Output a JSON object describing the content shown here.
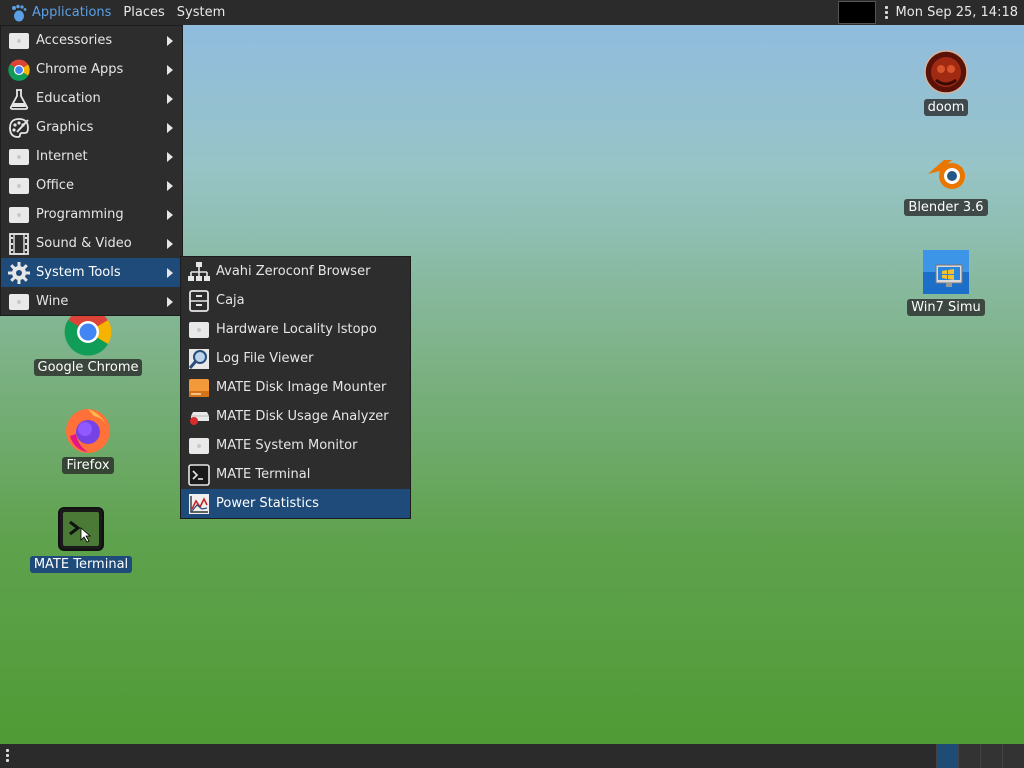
{
  "top_panel": {
    "menus": [
      "Applications",
      "Places",
      "System"
    ],
    "clock": "Mon Sep 25, 14:18"
  },
  "app_menu": {
    "items": [
      {
        "label": "Accessories",
        "icon": "generic-app-icon"
      },
      {
        "label": "Chrome Apps",
        "icon": "chrome-icon"
      },
      {
        "label": "Education",
        "icon": "flask-icon"
      },
      {
        "label": "Graphics",
        "icon": "palette-icon"
      },
      {
        "label": "Internet",
        "icon": "generic-app-icon"
      },
      {
        "label": "Office",
        "icon": "generic-app-icon"
      },
      {
        "label": "Programming",
        "icon": "generic-app-icon"
      },
      {
        "label": "Sound & Video",
        "icon": "film-icon"
      },
      {
        "label": "System Tools",
        "icon": "gear-icon"
      },
      {
        "label": "Wine",
        "icon": "generic-app-icon"
      }
    ],
    "highlighted": "System Tools"
  },
  "submenu": {
    "items": [
      {
        "label": "Avahi Zeroconf Browser",
        "icon": "network-icon"
      },
      {
        "label": "Caja",
        "icon": "file-cabinet-icon"
      },
      {
        "label": "Hardware Locality lstopo",
        "icon": "generic-app-icon"
      },
      {
        "label": "Log File Viewer",
        "icon": "magnifier-icon"
      },
      {
        "label": "MATE Disk Image Mounter",
        "icon": "disk-image-icon"
      },
      {
        "label": "MATE Disk Usage Analyzer",
        "icon": "disk-usage-icon"
      },
      {
        "label": "MATE System Monitor",
        "icon": "generic-app-icon"
      },
      {
        "label": "MATE Terminal",
        "icon": "terminal-icon"
      },
      {
        "label": "Power Statistics",
        "icon": "power-chart-icon"
      }
    ],
    "highlighted": "Power Statistics"
  },
  "desktop": {
    "icons": [
      {
        "label": "doom",
        "icon": "doom-icon"
      },
      {
        "label": "Blender 3.6",
        "icon": "blender-icon"
      },
      {
        "label": "Win7 Simu",
        "icon": "windows-icon"
      },
      {
        "label": "Google Chrome",
        "icon": "chrome-icon"
      },
      {
        "label": "Firefox",
        "icon": "firefox-icon"
      },
      {
        "label": "MATE Terminal",
        "icon": "terminal-icon"
      }
    ]
  },
  "colors": {
    "panel": "#2b2b2b",
    "highlight": "#1e4b7a",
    "menu_bg": "#2d2d2d",
    "active_menu_text": "#5aa0e6"
  }
}
